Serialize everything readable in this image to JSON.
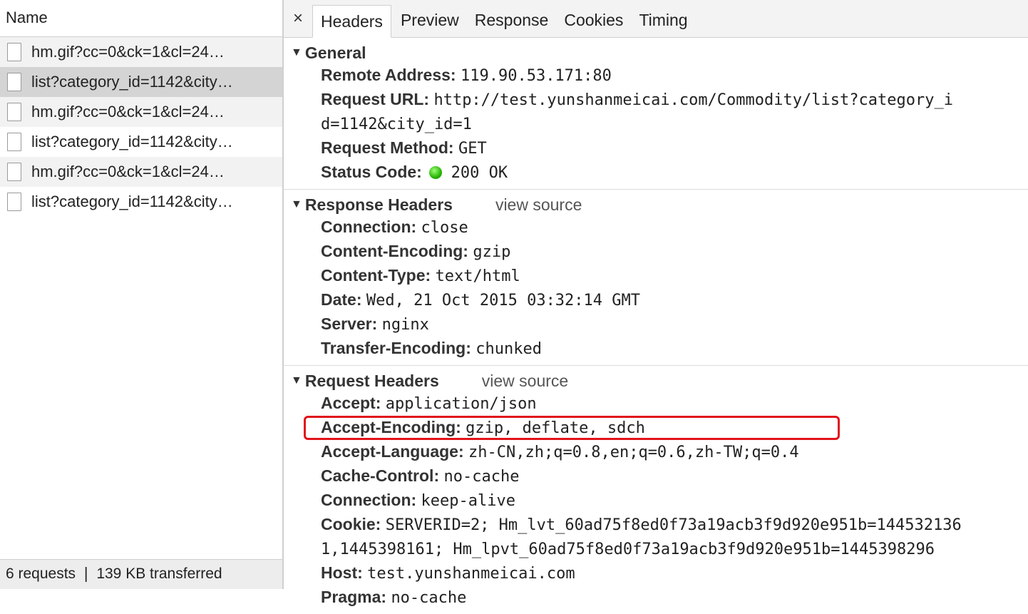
{
  "left": {
    "column_header": "Name",
    "requests": [
      {
        "name": "hm.gif?cc=0&ck=1&cl=24…",
        "style": "alt"
      },
      {
        "name": "list?category_id=1142&city…",
        "style": "selected"
      },
      {
        "name": "hm.gif?cc=0&ck=1&cl=24…",
        "style": "alt"
      },
      {
        "name": "list?category_id=1142&city…",
        "style": ""
      },
      {
        "name": "hm.gif?cc=0&ck=1&cl=24…",
        "style": "alt"
      },
      {
        "name": "list?category_id=1142&city…",
        "style": ""
      }
    ],
    "status": "6 requests  ❘  139 KB transferred"
  },
  "tabs": {
    "close": "×",
    "items": [
      "Headers",
      "Preview",
      "Response",
      "Cookies",
      "Timing"
    ],
    "active": "Headers"
  },
  "general": {
    "title": "General",
    "rows": [
      {
        "key": "Remote Address:",
        "value": "119.90.53.171:80"
      },
      {
        "key": "Request URL:",
        "value": "http://test.yunshanmeicai.com/Commodity/list?category_i d=1142&city_id=1"
      },
      {
        "key": "Request Method:",
        "value": "GET"
      }
    ],
    "status_key": "Status Code:",
    "status_value": "200 OK"
  },
  "response_headers": {
    "title": "Response Headers",
    "view_source": "view source",
    "rows": [
      {
        "key": "Connection:",
        "value": "close"
      },
      {
        "key": "Content-Encoding:",
        "value": "gzip"
      },
      {
        "key": "Content-Type:",
        "value": "text/html"
      },
      {
        "key": "Date:",
        "value": "Wed, 21 Oct 2015 03:32:14 GMT"
      },
      {
        "key": "Server:",
        "value": "nginx"
      },
      {
        "key": "Transfer-Encoding:",
        "value": "chunked"
      }
    ]
  },
  "request_headers": {
    "title": "Request Headers",
    "view_source": "view source",
    "rows": [
      {
        "key": "Accept:",
        "value": "application/json"
      },
      {
        "key": "Accept-Encoding:",
        "value": "gzip, deflate, sdch"
      },
      {
        "key": "Accept-Language:",
        "value": "zh-CN,zh;q=0.8,en;q=0.6,zh-TW;q=0.4"
      },
      {
        "key": "Cache-Control:",
        "value": "no-cache"
      },
      {
        "key": "Connection:",
        "value": "keep-alive"
      },
      {
        "key": "Cookie:",
        "value": "SERVERID=2; Hm_lvt_60ad75f8ed0f73a19acb3f9d920e951b=144532136 1,1445398161; Hm_lpvt_60ad75f8ed0f73a19acb3f9d920e951b=1445398296"
      },
      {
        "key": "Host:",
        "value": "test.yunshanmeicai.com"
      },
      {
        "key": "Pragma:",
        "value": "no-cache"
      }
    ],
    "highlighted_index": 1
  },
  "colors": {
    "highlight": "#e0141a",
    "status_ok": "#27b400"
  }
}
